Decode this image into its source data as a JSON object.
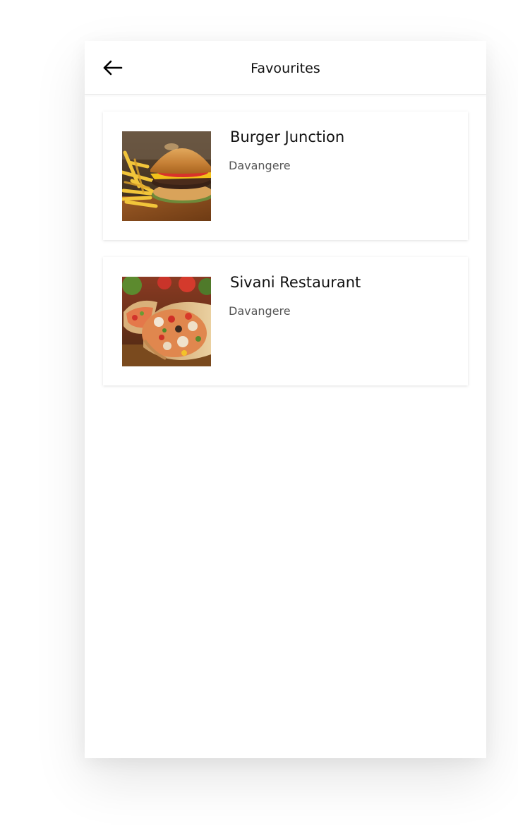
{
  "appbar": {
    "title": "Favourites",
    "back_icon": "arrow-left-icon"
  },
  "favourites": [
    {
      "name": "Burger Junction",
      "location": "Davangere",
      "image": "burger-and-fries-photo"
    },
    {
      "name": "Sivani Restaurant",
      "location": "Davangere",
      "image": "chicken-wrap-photo"
    }
  ],
  "colors": {
    "background": "#ffffff",
    "text_primary": "#111111",
    "text_secondary": "#555555",
    "divider": "#e9e9e9"
  }
}
